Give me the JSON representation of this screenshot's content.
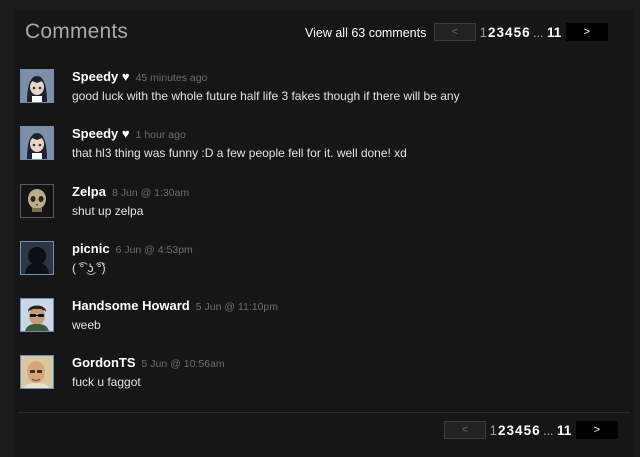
{
  "header": {
    "title": "Comments",
    "view_all": "View all 63 comments"
  },
  "pagination": {
    "prev": "<",
    "next": ">",
    "current_page": "1",
    "pages": [
      "2",
      "3",
      "4",
      "5",
      "6"
    ],
    "ellipsis": "...",
    "last_page": "11"
  },
  "comments": [
    {
      "author": "Speedy ♥",
      "timestamp": "45 minutes ago",
      "text": "good luck with the whole future half life 3 fakes though if there will be any",
      "avatar_icon": "anime-girl-avatar"
    },
    {
      "author": "Speedy ♥",
      "timestamp": "1 hour ago",
      "text": "that hl3 thing was funny :D a few people fell for it. well done! xd",
      "avatar_icon": "anime-girl-avatar"
    },
    {
      "author": "Zelpa",
      "timestamp": "8 Jun @ 1:30am",
      "text": "shut up zelpa",
      "avatar_icon": "skull-avatar"
    },
    {
      "author": "picnic",
      "timestamp": "6 Jun @ 4:53pm",
      "text": "( ͡° ͜ʖ ͡°)",
      "avatar_icon": "dark-silhouette-avatar"
    },
    {
      "author": "Handsome Howard",
      "timestamp": "5 Jun @ 11:10pm",
      "text": "weeb",
      "avatar_icon": "sunglasses-man-avatar"
    },
    {
      "author": "GordonTS",
      "timestamp": "5 Jun @ 10:56am",
      "text": "fuck u faggot",
      "avatar_icon": "bald-man-avatar"
    }
  ],
  "colors": {
    "background": "#1b1b1b",
    "avatar_border": "#6b8fb8",
    "timestamp": "#6e6e6e"
  }
}
